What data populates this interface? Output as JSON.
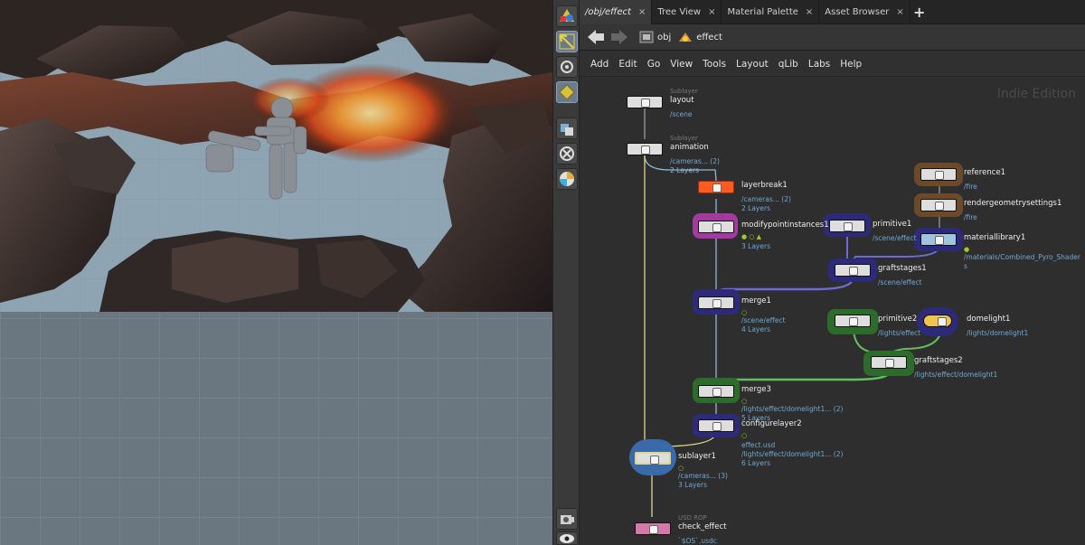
{
  "tabs": [
    {
      "label": "/obj/effect",
      "active": true
    },
    {
      "label": "Tree View",
      "active": false
    },
    {
      "label": "Material Palette",
      "active": false
    },
    {
      "label": "Asset Browser",
      "active": false
    }
  ],
  "tab_close_glyph": "×",
  "tab_add_glyph": "+",
  "path": {
    "crumbs": [
      {
        "label": "obj",
        "icon": "obj-network-icon"
      },
      {
        "label": "effect",
        "icon": "effect-node-icon"
      }
    ]
  },
  "menu": [
    "Add",
    "Edit",
    "Go",
    "View",
    "Tools",
    "Layout",
    "qLib",
    "Labs",
    "Help"
  ],
  "edition_label": "Indie Edition",
  "nodes": {
    "layout": {
      "type": "Sublayer",
      "name": "layout",
      "info": [
        "/scene"
      ]
    },
    "animation": {
      "type": "Sublayer",
      "name": "animation",
      "info": [
        "/cameras... (2)",
        "2 Layers"
      ]
    },
    "layerbreak1": {
      "name": "layerbreak1",
      "info": [
        "/cameras... (2)",
        "2 Layers"
      ]
    },
    "modifypointinstances1": {
      "name": "modifypointinstances1",
      "flags": "● ○ ▲",
      "info": [
        "3 Layers"
      ]
    },
    "primitive1": {
      "name": "primitive1",
      "info": [
        "/scene/effect"
      ]
    },
    "reference1": {
      "name": "reference1",
      "info": [
        "/fire"
      ]
    },
    "rendergeometrysettings1": {
      "name": "rendergeometrysettings1",
      "info": [
        "/fire"
      ]
    },
    "materiallibrary1": {
      "name": "materiallibrary1",
      "flags": "●",
      "info": [
        "/materials/Combined_Pyro_Shader",
        "s"
      ]
    },
    "graftstages1": {
      "name": "graftstages1",
      "info": [
        "/scene/effect"
      ]
    },
    "merge1": {
      "name": "merge1",
      "flags": "○",
      "info": [
        "/scene/effect",
        "4 Layers"
      ]
    },
    "primitive2": {
      "name": "primitive2",
      "info": [
        "/lights/effect"
      ]
    },
    "domelight1": {
      "name": "domelight1",
      "info": [
        "/lights/domelight1"
      ]
    },
    "graftstages2": {
      "name": "graftstages2",
      "info": [
        "/lights/effect/domelight1"
      ]
    },
    "merge3": {
      "name": "merge3",
      "flags": "○",
      "info": [
        "/lights/effect/domelight1... (2)",
        "5 Layers"
      ]
    },
    "configurelayer2": {
      "name": "configurelayer2",
      "flags": "○",
      "info": [
        "effect.usd",
        "/lights/effect/domelight1... (2)",
        "6 Layers"
      ]
    },
    "sublayer1": {
      "name": "sublayer1",
      "flags": "○",
      "info": [
        "/cameras... (3)",
        "3 Layers"
      ]
    },
    "check_effect": {
      "type": "USD ROP",
      "name": "check_effect",
      "info": [
        "`$OS`.usdc"
      ]
    }
  },
  "shelf_tools": [
    "object-mode-icon",
    "select-icon",
    "view-tool-icon",
    "handle-tool-icon",
    "display-options-icon",
    "snapping-icon",
    "color-wheel-icon",
    "render-icon",
    "eye-icon"
  ],
  "colors": {
    "accent_blue": "#6fa8d4",
    "network_bg": "#2e2e2e",
    "purple_node": "#2e2a7a",
    "green_node": "#2c6b2c",
    "brown_node": "#6b4a2c",
    "magenta_node": "#a23aa0"
  }
}
